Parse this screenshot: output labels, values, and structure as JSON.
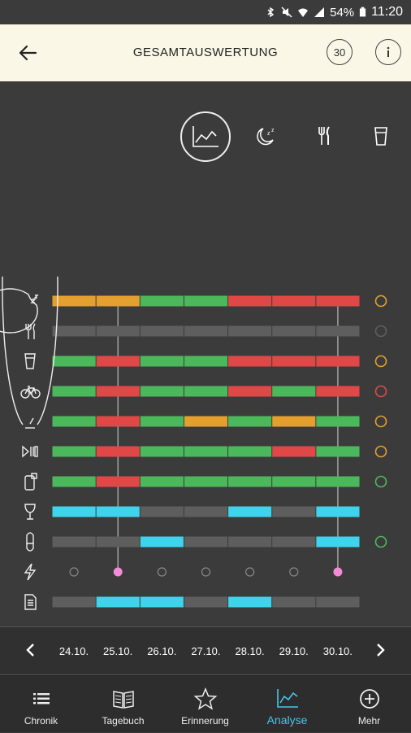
{
  "status_bar": {
    "battery": "54%",
    "time": "11:20",
    "icons": [
      "bluetooth-icon",
      "mute-icon",
      "wifi-icon",
      "signal-icon",
      "battery-icon"
    ]
  },
  "header": {
    "title": "GESAMTAUSWERTUNG",
    "period_button": "30",
    "info_icon": "info-icon",
    "back_icon": "back-arrow-icon",
    "background": "#fbf7e6"
  },
  "modes": [
    {
      "name": "overview",
      "icon": "chart-line-icon",
      "selected": true
    },
    {
      "name": "sleep",
      "icon": "moon-sleep-icon",
      "selected": false
    },
    {
      "name": "food",
      "icon": "fork-knife-icon",
      "selected": false
    },
    {
      "name": "drink",
      "icon": "glass-icon",
      "selected": false
    }
  ],
  "colors": {
    "green": "#4cb85c",
    "red": "#e04848",
    "orange": "#e4a02e",
    "gray": "#5e5e5e",
    "cyan": "#3fd3ec",
    "pink": "#f58ad8",
    "accent": "#46c6e8"
  },
  "grid": {
    "rows": [
      {
        "icon": "moon-sleep-icon",
        "cells": [
          "orange",
          "orange",
          "green",
          "green",
          "red",
          "red",
          "red"
        ],
        "indicator": "orange"
      },
      {
        "icon": "fork-knife-icon",
        "cells": [
          "gray",
          "gray",
          "gray",
          "gray",
          "gray",
          "gray",
          "gray"
        ],
        "indicator": "gray"
      },
      {
        "icon": "glass-icon",
        "cells": [
          "green",
          "red",
          "green",
          "green",
          "red",
          "red",
          "red"
        ],
        "indicator": "orange"
      },
      {
        "icon": "bicycle-icon",
        "cells": [
          "green",
          "red",
          "green",
          "green",
          "red",
          "green",
          "red"
        ],
        "indicator": "red"
      },
      {
        "icon": "stress-gauge-icon",
        "cells": [
          "green",
          "red",
          "green",
          "orange",
          "green",
          "orange",
          "green"
        ],
        "indicator": "orange"
      },
      {
        "icon": "media-playpause-icon",
        "cells": [
          "green",
          "red",
          "green",
          "green",
          "green",
          "red",
          "green"
        ],
        "indicator": "orange"
      },
      {
        "icon": "phone-note-icon",
        "cells": [
          "green",
          "red",
          "green",
          "green",
          "green",
          "green",
          "green"
        ],
        "indicator": "green"
      },
      {
        "icon": "wine-glass-icon",
        "cells": [
          "cyan",
          "cyan",
          "gray",
          "gray",
          "cyan",
          "gray",
          "cyan"
        ],
        "indicator": ""
      },
      {
        "icon": "pill-icon",
        "cells": [
          "gray",
          "gray",
          "cyan",
          "gray",
          "gray",
          "gray",
          "cyan"
        ],
        "indicator": "green"
      },
      {
        "icon": "lightning-icon",
        "type": "dots",
        "cells": [
          "empty",
          "pink",
          "empty",
          "empty",
          "empty",
          "empty",
          "pink"
        ],
        "indicator": ""
      },
      {
        "icon": "document-icon",
        "cells": [
          "gray",
          "cyan",
          "cyan",
          "gray",
          "cyan",
          "gray",
          "gray"
        ],
        "indicator": ""
      }
    ],
    "marked_columns": [
      1,
      6
    ]
  },
  "dates": [
    "24.10.",
    "25.10.",
    "26.10.",
    "27.10.",
    "28.10.",
    "29.10.",
    "30.10."
  ],
  "tabs": [
    {
      "label": "Chronik",
      "icon": "list-icon",
      "active": false
    },
    {
      "label": "Tagebuch",
      "icon": "book-icon",
      "active": false
    },
    {
      "label": "Erinnerung",
      "icon": "star-icon",
      "active": false
    },
    {
      "label": "Analyse",
      "icon": "chart-line-icon",
      "active": true
    },
    {
      "label": "Mehr",
      "icon": "plus-circle-icon",
      "active": false
    }
  ]
}
